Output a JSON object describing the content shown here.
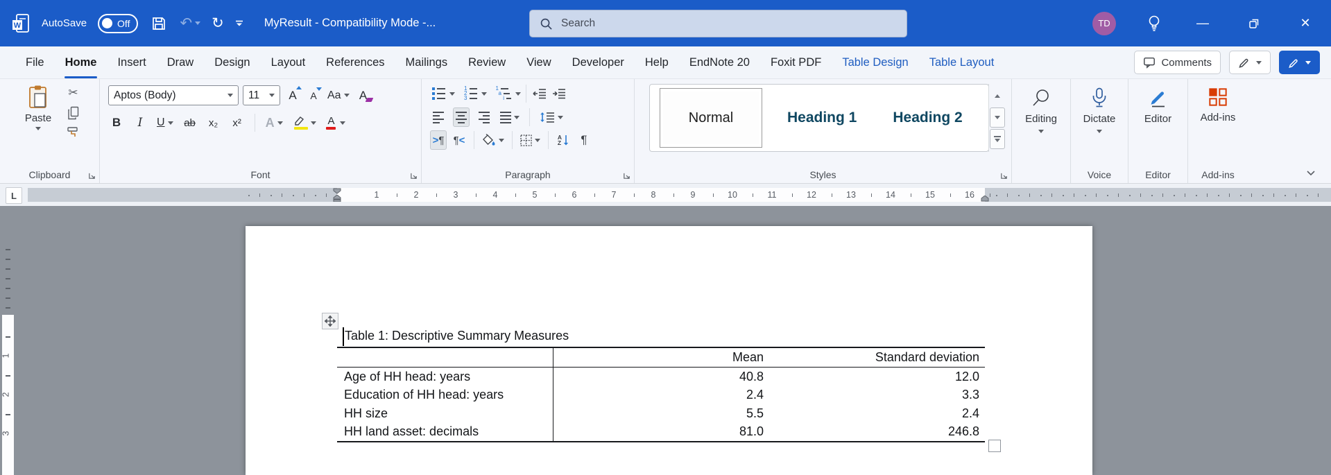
{
  "titlebar": {
    "autosave_label": "AutoSave",
    "autosave_state": "Off",
    "title": "MyResult  -  Compatibility Mode  -...",
    "search_placeholder": "Search",
    "avatar_initials": "TD"
  },
  "tabs": {
    "items": [
      "File",
      "Home",
      "Insert",
      "Draw",
      "Design",
      "Layout",
      "References",
      "Mailings",
      "Review",
      "View",
      "Developer",
      "Help",
      "EndNote 20",
      "Foxit PDF",
      "Table Design",
      "Table Layout"
    ],
    "active": "Home",
    "contextual": [
      "Table Design",
      "Table Layout"
    ],
    "comments_label": "Comments"
  },
  "ribbon": {
    "clipboard": {
      "label": "Clipboard",
      "paste_label": "Paste"
    },
    "font": {
      "label": "Font",
      "name": "Aptos (Body)",
      "size": "11",
      "bold": "B",
      "italic": "I",
      "underline": "U",
      "strikethrough": "ab",
      "subscript": "x₂",
      "superscript": "x²",
      "change_case": "Aa",
      "grow": "A",
      "shrink": "A",
      "effects": "A",
      "clear": "A",
      "color": "A"
    },
    "paragraph": {
      "label": "Paragraph",
      "pilcrow": "¶",
      "ltr_arrow": ">",
      "rtl_arrow": "<",
      "numbered": [
        "1",
        "2",
        "3"
      ],
      "multilevel": [
        "1",
        "a",
        "i"
      ],
      "sort": [
        "A",
        "Z"
      ]
    },
    "styles": {
      "label": "Styles",
      "items": [
        "Normal",
        "Heading 1",
        "Heading 2"
      ],
      "selected": "Normal"
    },
    "editing": {
      "button": "Editing"
    },
    "voice": {
      "label": "Voice",
      "button": "Dictate"
    },
    "editor": {
      "label": "Editor",
      "button": "Editor"
    },
    "addins": {
      "label": "Add-ins",
      "button": "Add-ins"
    }
  },
  "icons": {
    "scissors": "✂",
    "undo": "↶",
    "redo": "↻",
    "minimize": "—",
    "close": "✕"
  },
  "ruler": {
    "h_numbers": [
      "1",
      "2",
      "3",
      "4",
      "5",
      "6",
      "7",
      "8",
      "9",
      "10",
      "11",
      "12",
      "13",
      "14",
      "15",
      "16"
    ],
    "v_numbers": [
      "1",
      "2",
      "3"
    ]
  },
  "document": {
    "caption": "Table 1: Descriptive Summary Measures",
    "table": {
      "headers": [
        "",
        "Mean",
        "Standard deviation"
      ],
      "rows": [
        [
          "Age of HH head: years",
          "40.8",
          "12.0"
        ],
        [
          "Education of HH head: years",
          "2.4",
          "3.3"
        ],
        [
          "HH size",
          "5.5",
          "2.4"
        ],
        [
          "HH land asset: decimals",
          "81.0",
          "246.8"
        ]
      ]
    }
  },
  "colors": {
    "titlebar": "#1b5cc8",
    "accent": "#1b5cc8",
    "search_bg": "#ccd8ec",
    "contextual": "#1f5dc0",
    "heading": "#0F4761",
    "avatar": "#A05CA5",
    "icon_blue": "#2b7cd3",
    "highlight": "#f3e612",
    "font_red": "#e01b1b",
    "eraser": "#9b30a5",
    "addins_red": "#d83b01"
  }
}
